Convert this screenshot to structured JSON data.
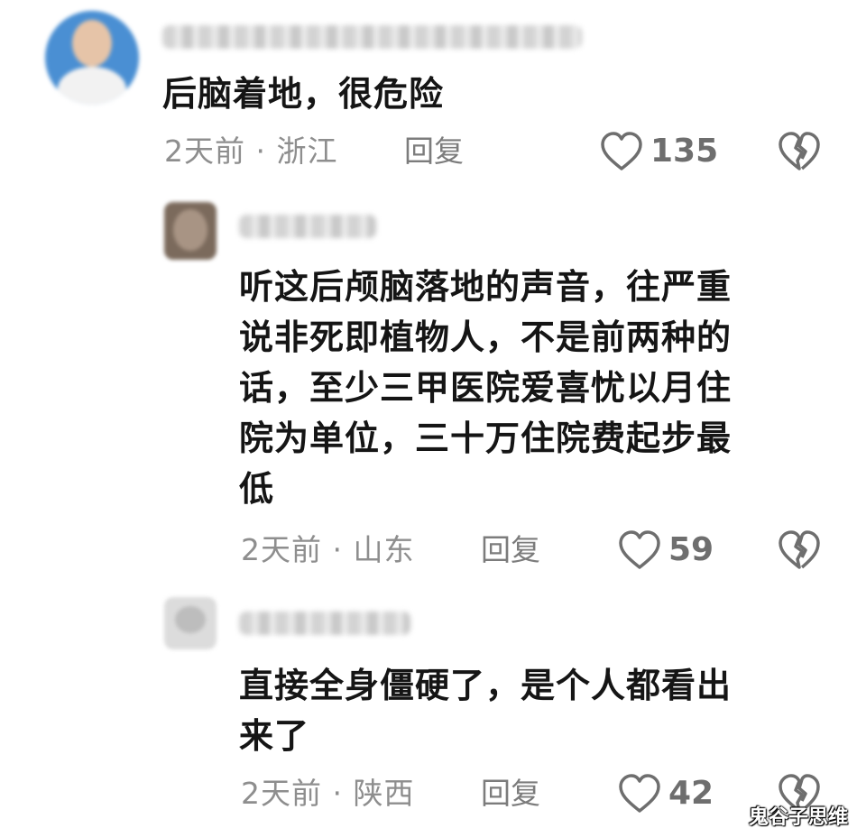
{
  "comments": [
    {
      "text_lines": [
        "后脑着地，很危险"
      ],
      "meta": "2天前 · 浙江",
      "reply_label": "回复",
      "likes": "135"
    },
    {
      "text_lines": [
        "听这后颅脑落地的声音，往严重",
        "说非死即植物人，不是前两种的",
        "话，至少三甲医院爱喜忧以月住",
        "院为单位，三十万住院费起步最",
        "低"
      ],
      "meta": "2天前 · 山东",
      "reply_label": "回复",
      "likes": "59"
    },
    {
      "text_lines": [
        "直接全身僵硬了，是个人都看出",
        "来了"
      ],
      "meta": "2天前 · 陕西",
      "reply_label": "回复",
      "likes": "42"
    }
  ],
  "watermark": "鬼谷子思维",
  "colors": {
    "text": "#151515",
    "meta": "#8e8e8e",
    "icon": "#6e6e6e",
    "background": "#ffffff"
  },
  "icons": {
    "like": "heart-outline",
    "dislike": "broken-heart"
  }
}
